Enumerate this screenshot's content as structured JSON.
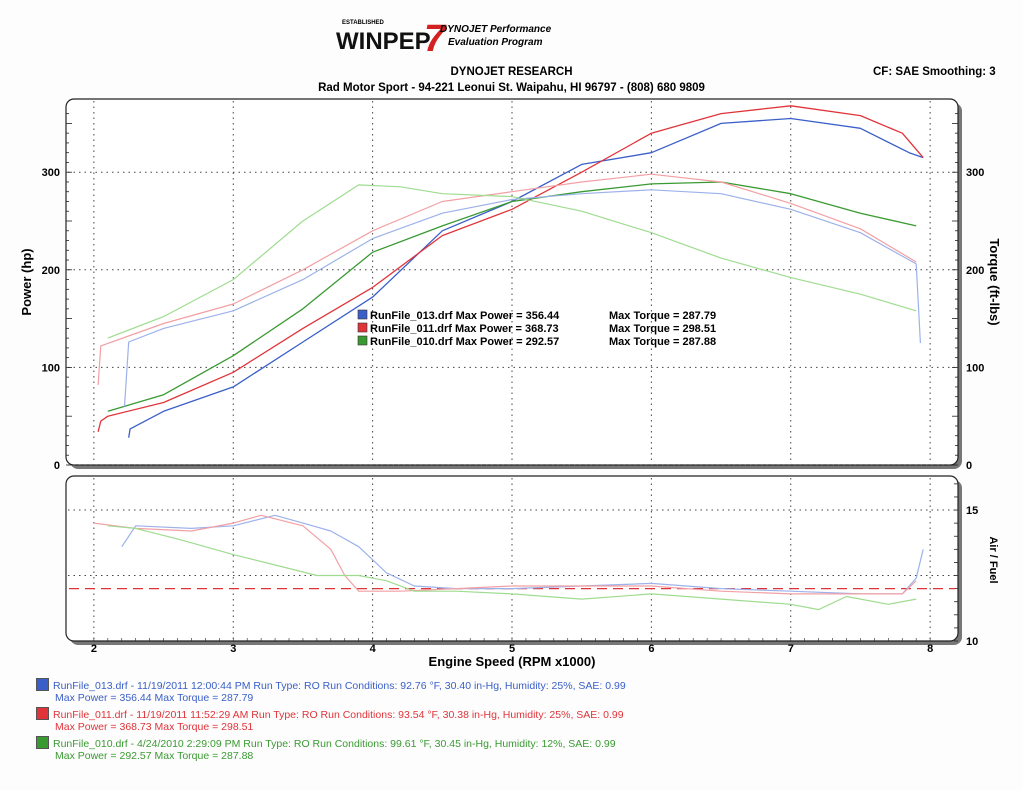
{
  "logo": {
    "small": "ESTABLISHED",
    "winpep": "WINPEP",
    "seven": "7",
    "line1": "DYNOJET Performance",
    "line2": "Evaluation Program"
  },
  "header": {
    "company": "DYNOJET RESEARCH",
    "address": "Rad Motor Sport - 94-221 Leonui St. Waipahu, HI 96797 - (808) 680 9809",
    "cf": "CF: SAE  Smoothing: 3"
  },
  "colors": {
    "run013": "#3a5fc8",
    "run011": "#e0343a",
    "run010": "#3a9a32",
    "run013_light": "#9db2ea",
    "run011_light": "#f2a0a4",
    "run010_light": "#9fdc90"
  },
  "chart_data": [
    {
      "type": "line",
      "xlabel": "Engine Speed (RPM x1000)",
      "ylabel": "Power (hp)",
      "y2label": "Torque (ft-lbs)",
      "xlim": [
        1.8,
        8.2
      ],
      "ylim": [
        0,
        375
      ],
      "xticks": [
        "2",
        "3",
        "4",
        "5",
        "6",
        "7",
        "8"
      ],
      "yticks": [
        "0",
        "100",
        "200",
        "300"
      ],
      "y2ticks": [
        "0",
        "100",
        "200",
        "300"
      ],
      "grid": true,
      "series": [
        {
          "name": "RunFile_013.drf",
          "kind": "power",
          "x": [
            2.25,
            2.26,
            2.5,
            3,
            3.5,
            4,
            4.5,
            5,
            5.5,
            6,
            6.5,
            7,
            7.5,
            7.85,
            7.95
          ],
          "y": [
            28,
            37,
            55,
            80,
            126,
            172,
            240,
            270,
            308,
            320,
            350,
            355,
            345,
            320,
            315
          ]
        },
        {
          "name": "RunFile_011.drf",
          "kind": "power",
          "x": [
            2.03,
            2.05,
            2.1,
            2.5,
            3,
            3.5,
            4,
            4.5,
            5,
            5.5,
            6,
            6.5,
            7,
            7.5,
            7.8,
            7.95
          ],
          "y": [
            34,
            45,
            50,
            64,
            95,
            140,
            182,
            235,
            262,
            300,
            340,
            360,
            368,
            358,
            340,
            315
          ]
        },
        {
          "name": "RunFile_010.drf",
          "kind": "power",
          "x": [
            2.1,
            2.5,
            3,
            3.5,
            4,
            4.5,
            5,
            5.5,
            6,
            6.5,
            7,
            7.5,
            7.9
          ],
          "y": [
            55,
            72,
            112,
            160,
            218,
            245,
            270,
            280,
            288,
            290,
            278,
            258,
            245
          ]
        },
        {
          "name": "RunFile_013.drf",
          "kind": "torque",
          "x": [
            2.22,
            2.25,
            2.5,
            3,
            3.5,
            4,
            4.5,
            5,
            5.5,
            6,
            6.5,
            7,
            7.5,
            7.9,
            7.93
          ],
          "y": [
            60,
            126,
            140,
            158,
            190,
            232,
            258,
            272,
            278,
            282,
            278,
            262,
            238,
            206,
            125
          ]
        },
        {
          "name": "RunFile_011.drf",
          "kind": "torque",
          "x": [
            2.03,
            2.05,
            2.5,
            3,
            3.5,
            4,
            4.5,
            5,
            5.5,
            6,
            6.5,
            7,
            7.5,
            7.9
          ],
          "y": [
            82,
            122,
            145,
            165,
            200,
            240,
            270,
            280,
            290,
            298,
            290,
            268,
            242,
            208
          ]
        },
        {
          "name": "RunFile_010.drf",
          "kind": "torque",
          "x": [
            2.1,
            2.5,
            3,
            3.5,
            3.9,
            4.2,
            4.5,
            5,
            5.5,
            6,
            6.5,
            7,
            7.5,
            7.9
          ],
          "y": [
            130,
            152,
            190,
            250,
            287,
            285,
            278,
            275,
            260,
            238,
            212,
            192,
            175,
            158
          ]
        }
      ],
      "annotations": [
        {
          "name": "RunFile_013.drf",
          "max_power_label": "RunFile_013.drf Max Power = 356.44",
          "max_torque_label": "Max Torque = 287.79"
        },
        {
          "name": "RunFile_011.drf",
          "max_power_label": "RunFile_011.drf Max Power = 368.73",
          "max_torque_label": "Max Torque = 298.51"
        },
        {
          "name": "RunFile_010.drf",
          "max_power_label": "RunFile_010.drf Max Power = 292.57",
          "max_torque_label": "Max Torque = 287.88"
        }
      ]
    },
    {
      "type": "line",
      "ylabel": "Air / Fuel",
      "xlim": [
        1.8,
        8.2
      ],
      "ylim": [
        10,
        16.3
      ],
      "yticks": [
        "10",
        "15"
      ],
      "grid": true,
      "reference_line": 12.0,
      "series": [
        {
          "name": "RunFile_013.drf",
          "x": [
            2.2,
            2.3,
            2.7,
            3,
            3.3,
            3.5,
            3.7,
            3.9,
            4.1,
            4.3,
            4.6,
            5,
            5.5,
            6,
            6.5,
            7,
            7.5,
            7.8,
            7.9,
            7.95
          ],
          "y": [
            13.6,
            14.4,
            14.3,
            14.4,
            14.8,
            14.5,
            14.2,
            13.6,
            12.6,
            12.1,
            12.0,
            12.0,
            12.1,
            12.2,
            12.0,
            11.9,
            11.8,
            11.8,
            12.4,
            13.5
          ]
        },
        {
          "name": "RunFile_011.drf",
          "x": [
            2,
            2.3,
            2.7,
            3,
            3.2,
            3.5,
            3.7,
            3.8,
            3.9,
            4.2,
            4.6,
            5,
            5.5,
            6,
            6.5,
            7,
            7.5,
            7.8,
            7.9
          ],
          "y": [
            14.5,
            14.3,
            14.2,
            14.5,
            14.8,
            14.4,
            13.5,
            12.5,
            11.9,
            11.9,
            12.0,
            12.1,
            12.1,
            12.1,
            11.9,
            11.8,
            11.8,
            11.8,
            12.3
          ]
        },
        {
          "name": "RunFile_010.drf",
          "x": [
            2.1,
            2.3,
            2.6,
            3,
            3.3,
            3.6,
            3.9,
            4.1,
            4.3,
            4.6,
            5,
            5.5,
            6,
            6.5,
            7,
            7.2,
            7.4,
            7.7,
            7.9
          ],
          "y": [
            14.4,
            14.3,
            13.9,
            13.3,
            12.9,
            12.5,
            12.5,
            12.3,
            11.9,
            11.9,
            11.8,
            11.6,
            11.8,
            11.6,
            11.4,
            11.2,
            11.7,
            11.4,
            11.6
          ]
        }
      ]
    }
  ],
  "footer": [
    {
      "line1": "RunFile_013.drf - 11/19/2011 12:00:44 PM  Run Type: RO  Run Conditions: 92.76 °F, 30.40 in-Hg,  Humidity:  25%, SAE: 0.99",
      "line2": "Max Power = 356.44  Max Torque = 287.79"
    },
    {
      "line1": "RunFile_011.drf - 11/19/2011 11:52:29 AM  Run Type: RO  Run Conditions: 93.54 °F, 30.38 in-Hg,  Humidity:  25%, SAE: 0.99",
      "line2": "Max Power = 368.73  Max Torque = 298.51"
    },
    {
      "line1": "RunFile_010.drf - 4/24/2010 2:29:09 PM  Run Type: RO  Run Conditions: 99.61 °F, 30.45 in-Hg,  Humidity:  12%, SAE: 0.99",
      "line2": "Max Power = 292.57  Max Torque = 287.88"
    }
  ]
}
